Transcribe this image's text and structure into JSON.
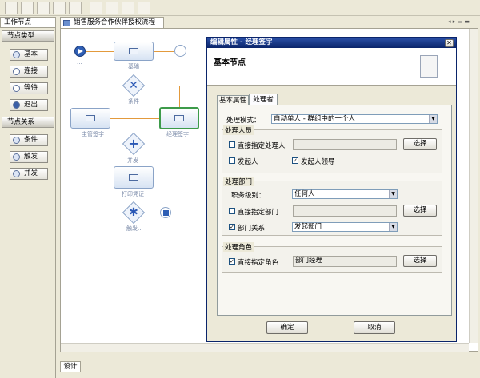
{
  "left_panel": {
    "tab": "工作节点",
    "sections": [
      {
        "title": "节点类型",
        "items": [
          {
            "label": "基本"
          },
          {
            "label": "连接"
          },
          {
            "label": "等待"
          },
          {
            "label": "退出"
          }
        ]
      },
      {
        "title": "节点关系",
        "items": [
          {
            "label": "条件"
          },
          {
            "label": "触发"
          },
          {
            "label": "并发"
          }
        ]
      }
    ]
  },
  "editor": {
    "tab_title": "销售服务合作伙伴授权流程",
    "bottom_tab": "设计"
  },
  "diagram": {
    "labels": {
      "top_task": "基础",
      "condition": "条件",
      "left_task": "主管签字",
      "right_task": "经理签字",
      "fork": "并发",
      "print_task": "打印凭证",
      "trigger": "触发...",
      "start": "...",
      "end": "..."
    }
  },
  "dialog": {
    "title": "编辑属性 - 经理签字",
    "heading": "基本节点",
    "tabs": [
      {
        "label": "基本属性"
      },
      {
        "label": "处理者"
      }
    ],
    "mode_label": "处理模式：",
    "mode_value": "自动单人 - 群组中的一个人",
    "group_person": {
      "title": "处理人员",
      "direct_label": "直接指定处理人",
      "select_label": "选择",
      "initiator_label": "发起人",
      "initiator_leader_label": "发起人领导"
    },
    "group_dept": {
      "title": "处理部门",
      "rank_label": "职务级别：",
      "rank_value": "任何人",
      "direct_dept_label": "直接指定部门",
      "select_label": "选择",
      "relation_label": "部门关系",
      "relation_value": "发起部门"
    },
    "group_role": {
      "title": "处理角色",
      "direct_role_label": "直接指定角色",
      "role_value": "部门经理",
      "select_label": "选择"
    },
    "ok_label": "确定",
    "cancel_label": "取消"
  }
}
